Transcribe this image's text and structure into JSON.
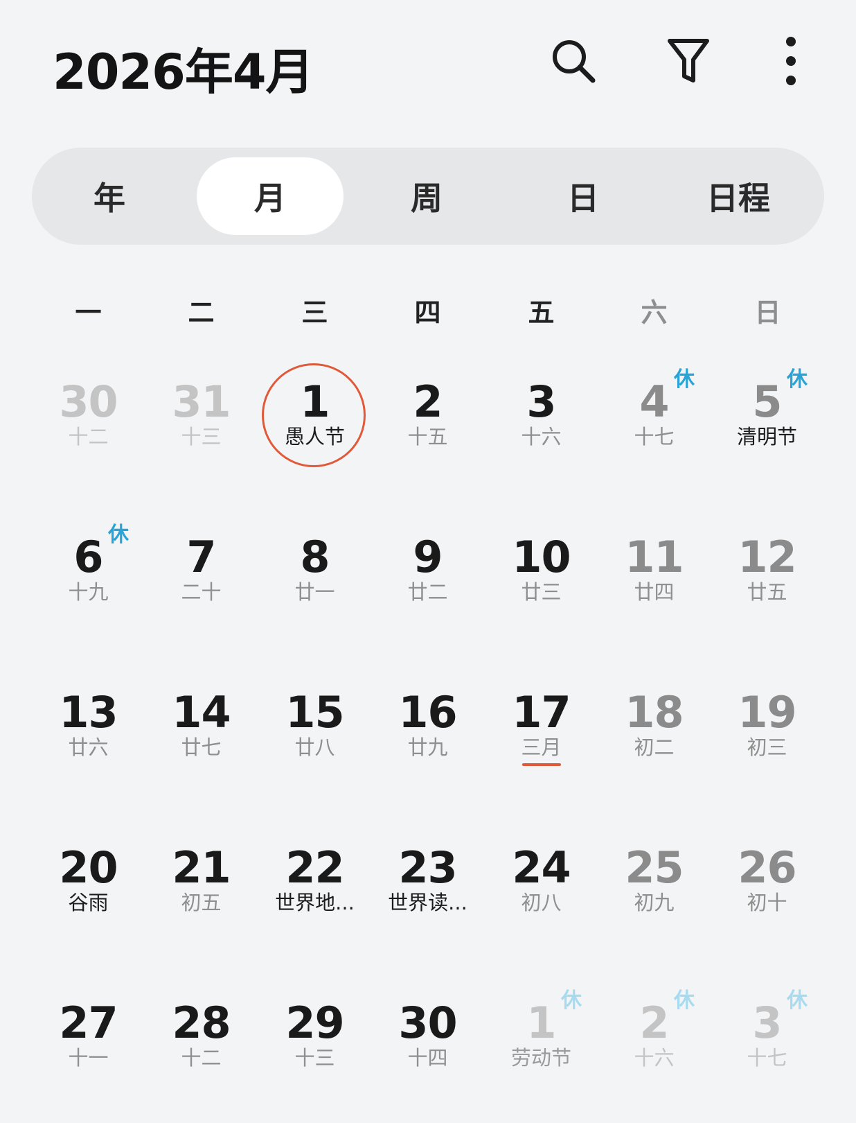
{
  "header": {
    "title": "2026年4月",
    "icons": [
      "search-icon",
      "filter-icon",
      "more-vertical-icon"
    ]
  },
  "views": {
    "tabs": [
      {
        "label": "年",
        "active": false
      },
      {
        "label": "月",
        "active": true
      },
      {
        "label": "周",
        "active": false
      },
      {
        "label": "日",
        "active": false
      },
      {
        "label": "日程",
        "active": false
      }
    ]
  },
  "weekdays": [
    "一",
    "二",
    "三",
    "四",
    "五",
    "六",
    "日"
  ],
  "calendar": {
    "rest_label": "休",
    "weeks": [
      [
        {
          "day": "30",
          "sub": "十二",
          "other": true
        },
        {
          "day": "31",
          "sub": "十三",
          "other": true
        },
        {
          "day": "1",
          "sub": "愚人节",
          "holiday": true,
          "today": true
        },
        {
          "day": "2",
          "sub": "十五"
        },
        {
          "day": "3",
          "sub": "十六"
        },
        {
          "day": "4",
          "sub": "十七",
          "rest": true,
          "weekend": true
        },
        {
          "day": "5",
          "sub": "清明节",
          "holiday": true,
          "rest": true,
          "weekend": true
        }
      ],
      [
        {
          "day": "6",
          "sub": "十九",
          "rest": true
        },
        {
          "day": "7",
          "sub": "二十"
        },
        {
          "day": "8",
          "sub": "廿一"
        },
        {
          "day": "9",
          "sub": "廿二"
        },
        {
          "day": "10",
          "sub": "廿三"
        },
        {
          "day": "11",
          "sub": "廿四",
          "weekend": true
        },
        {
          "day": "12",
          "sub": "廿五",
          "weekend": true
        }
      ],
      [
        {
          "day": "13",
          "sub": "廿六"
        },
        {
          "day": "14",
          "sub": "廿七"
        },
        {
          "day": "15",
          "sub": "廿八"
        },
        {
          "day": "16",
          "sub": "廿九"
        },
        {
          "day": "17",
          "sub": "三月",
          "marked": true
        },
        {
          "day": "18",
          "sub": "初二",
          "weekend": true
        },
        {
          "day": "19",
          "sub": "初三",
          "weekend": true
        }
      ],
      [
        {
          "day": "20",
          "sub": "谷雨",
          "holiday": true
        },
        {
          "day": "21",
          "sub": "初五"
        },
        {
          "day": "22",
          "sub": "世界地...",
          "holiday": true
        },
        {
          "day": "23",
          "sub": "世界读...",
          "holiday": true
        },
        {
          "day": "24",
          "sub": "初八"
        },
        {
          "day": "25",
          "sub": "初九",
          "weekend": true
        },
        {
          "day": "26",
          "sub": "初十",
          "weekend": true
        }
      ],
      [
        {
          "day": "27",
          "sub": "十一"
        },
        {
          "day": "28",
          "sub": "十二"
        },
        {
          "day": "29",
          "sub": "十三"
        },
        {
          "day": "30",
          "sub": "十四"
        },
        {
          "day": "1",
          "sub": "劳动节",
          "holiday": true,
          "rest": true,
          "other": true
        },
        {
          "day": "2",
          "sub": "十六",
          "rest": true,
          "other": true
        },
        {
          "day": "3",
          "sub": "十七",
          "rest": true,
          "other": true
        }
      ]
    ]
  },
  "colors": {
    "background": "#f3f4f6",
    "today_ring": "#e05a3a",
    "rest_badge": "#2aa4d6"
  }
}
